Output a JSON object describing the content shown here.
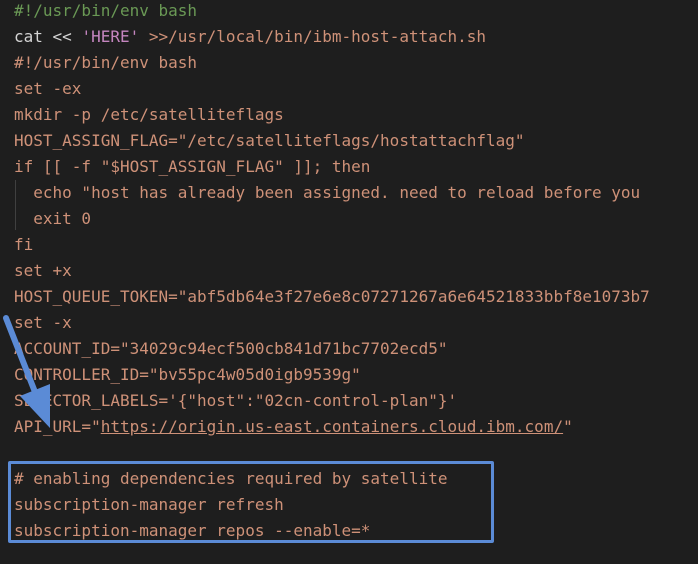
{
  "code": {
    "lines": [
      {
        "text": "#!/usr/bin/env bash"
      },
      {
        "a": "cat << ",
        "b": "'HERE'",
        "c": " >>/usr/local/bin/ibm-host-attach.sh"
      },
      {
        "text": "#!/usr/bin/env bash"
      },
      {
        "text": "set -ex"
      },
      {
        "text": "mkdir -p /etc/satelliteflags"
      },
      {
        "text": "HOST_ASSIGN_FLAG=\"/etc/satelliteflags/hostattachflag\""
      },
      {
        "text": "if [[ -f \"$HOST_ASSIGN_FLAG\" ]]; then"
      },
      {
        "text": "  echo \"host has already been assigned. need to reload before you"
      },
      {
        "text": "  exit 0"
      },
      {
        "text": "fi"
      },
      {
        "text": "set +x"
      },
      {
        "text": "HOST_QUEUE_TOKEN=\"abf5db64e3f27e6e8c07271267a6e64521833bbf8e1073b7"
      },
      {
        "text": "set -x"
      },
      {
        "text": "ACCOUNT_ID=\"34029c94ecf500cb841d71bc7702ecd5\""
      },
      {
        "text": "CONTROLLER_ID=\"bv55pc4w05d0igb9539g\""
      },
      {
        "text": "SELECTOR_LABELS='{\"host\":\"02cn-control-plan\"}'"
      },
      {
        "a": "API_URL=\"",
        "url": "https://origin.us-east.containers.cloud.ibm.com/",
        "c": "\""
      },
      {
        "text": ""
      },
      {
        "text": "# enabling dependencies required by satellite"
      },
      {
        "text": "subscription-manager refresh"
      },
      {
        "text": "subscription-manager repos --enable=*"
      }
    ]
  },
  "annotation": {
    "arrow_color": "#5b8bd6",
    "box_color": "#5b8bd6"
  },
  "colors": {
    "background": "#1e1e1e",
    "string": "#ce9178",
    "comment": "#6a9955",
    "keyword": "#c586c0",
    "plain": "#d4d4d4"
  }
}
